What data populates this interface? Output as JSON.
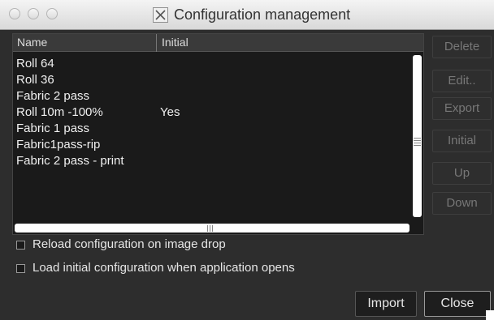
{
  "window": {
    "title": "Configuration management"
  },
  "table": {
    "columns": [
      "Name",
      "Initial"
    ],
    "rows": [
      {
        "name": "Roll 64",
        "initial": ""
      },
      {
        "name": "Roll 36",
        "initial": ""
      },
      {
        "name": "Fabric 2 pass",
        "initial": ""
      },
      {
        "name": "Roll 10m -100%",
        "initial": "Yes"
      },
      {
        "name": "Fabric 1 pass",
        "initial": ""
      },
      {
        "name": "Fabric1pass-rip",
        "initial": ""
      },
      {
        "name": "Fabric 2 pass - print",
        "initial": ""
      }
    ]
  },
  "buttons": {
    "delete": "Delete",
    "edit": "Edit..",
    "export": "Export",
    "initial": "Initial",
    "up": "Up",
    "down": "Down",
    "import": "Import",
    "close": "Close"
  },
  "options": {
    "reload_on_drop": {
      "label": "Reload configuration on image drop",
      "checked": false
    },
    "load_initial_on_open": {
      "label": "Load initial configuration when application opens",
      "checked": false
    }
  },
  "icons": [
    "app-x-icon",
    "close-window-icon",
    "minimize-window-icon",
    "zoom-window-icon"
  ]
}
